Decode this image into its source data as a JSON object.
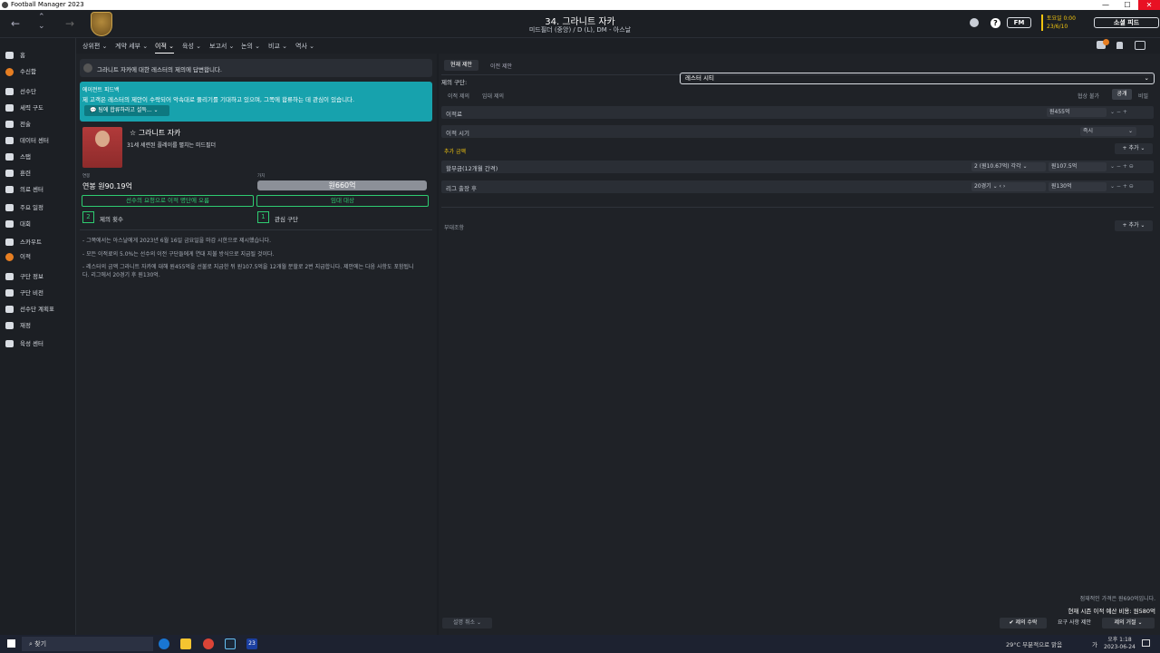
{
  "window": {
    "title": "Football Manager 2023",
    "min": "—",
    "max": "☐",
    "close": "✕"
  },
  "header": {
    "player_title": "34. 그라니트 자카",
    "player_sub": "미드필더 (중앙) / D (L), DM - 아스날",
    "fm_label": "FM",
    "date_line1": "토요일 0:00",
    "date_line2": "23/6/10",
    "social_label": "소셜 피드"
  },
  "menu": [
    "상위편",
    "계약 세부",
    "이적",
    "육성",
    "보고서",
    "논의",
    "비교",
    "역사"
  ],
  "sidebar": [
    {
      "label": "홈",
      "icon": "home-icon"
    },
    {
      "label": "수신함",
      "icon": "inbox-icon",
      "badge": true
    },
    {
      "label": "선수단",
      "icon": "squad-icon"
    },
    {
      "label": "세력 구도",
      "icon": "dynamics-icon"
    },
    {
      "label": "전술",
      "icon": "tactics-icon"
    },
    {
      "label": "데이터 센터",
      "icon": "data-icon"
    },
    {
      "label": "스탭",
      "icon": "staff-icon"
    },
    {
      "label": "훈련",
      "icon": "training-icon"
    },
    {
      "label": "의료 센터",
      "icon": "medical-icon"
    },
    {
      "label": "주요 일정",
      "icon": "calendar-icon"
    },
    {
      "label": "대회",
      "icon": "trophy-icon"
    },
    {
      "label": "스카우트",
      "icon": "scout-icon"
    },
    {
      "label": "이적",
      "icon": "transfer-icon",
      "badge": true
    },
    {
      "label": "구단 정보",
      "icon": "club-icon"
    },
    {
      "label": "구단 비전",
      "icon": "vision-icon"
    },
    {
      "label": "선수단 계획표",
      "icon": "plan-icon"
    },
    {
      "label": "재정",
      "icon": "finance-icon"
    },
    {
      "label": "육성 센터",
      "icon": "dev-icon"
    }
  ],
  "left": {
    "notice": "그라니트 자카에 대한 레스터의 제의에 답변합니다.",
    "agent_title": "에이전트 피드백",
    "agent_text": "제 고객은 레스터의 제안이 수락되어 악속대로 풀리기를 기대하고 있으며, 그쪽에 합류하는 데 관심이 있습니다.",
    "persuade_btn": "팀에 합류하라고 설득...",
    "player_name": "그라니트 자카",
    "player_desc": "31세 세련된 플레이를 펼치는 미드필더",
    "wage_small": "연봉",
    "wage": "연봉 원90.19억",
    "value_small": "가치",
    "value": "원660억",
    "btn_listed": "선수의 요청으로 이적 명단에 오름",
    "btn_loan": "임대 대상",
    "offers_count": "2",
    "offers_label": "제의 횟수",
    "interest_count": "1",
    "interest_label": "관심 구단",
    "notes": [
      "그쪽에서는 아스날에게 2023년 6월 16일 금요일을 마감 시한으로 제시했습니다.",
      "모든 이적료의 5.0%는 선수의 이전 구단들에게 연대 지불 방식으로 지급될 것이다.",
      "레스터의 금액 그라니트 자카에 대해 원455억을 선불로 지급한 뒤 원107.5억을 12개월 분할로 2번 지급합니다. 제안에는 다음 사항도 포함됩니다. 리그에서 20경기 후 원130억."
    ]
  },
  "right": {
    "tab1": "현재 제안",
    "tab2": "이전 제안",
    "club_label": "제의 구단:",
    "club_value": "레스터 시티",
    "sub1": "이적 제의",
    "sub2": "임대 제의",
    "tog1": "협상 불가",
    "tog2": "공개",
    "tog3": "비밀",
    "fee_label": "이적료",
    "fee_value": "원455억",
    "time_label": "이적 시기",
    "time_value": "즉시",
    "extra_label": "추가 금액",
    "add_label": "+ 추가",
    "inst_label": "할부금(12개월 간격)",
    "inst_count": "2 (원10.67억) 각각",
    "inst_value": "원107.5억",
    "league_label": "리그 출장 후",
    "league_count": "20경기",
    "league_value": "원130억",
    "cond_label": "부대조항",
    "fair_price": "점재적인 가격은 원690억입니다.",
    "budget": "현재 시즌 이적 예산 비용: 원580억",
    "cancel_btn": "설명 취소",
    "accept_btn": "✔ 제의 수락",
    "counter_btn": "요구 사항 제안",
    "reject_btn": "제의 거절"
  },
  "taskbar": {
    "search": "찾기",
    "weather": "29°C 부분적으로 맑음",
    "time": "오후 1:18",
    "date": "2023-06-24",
    "lang": "가"
  }
}
